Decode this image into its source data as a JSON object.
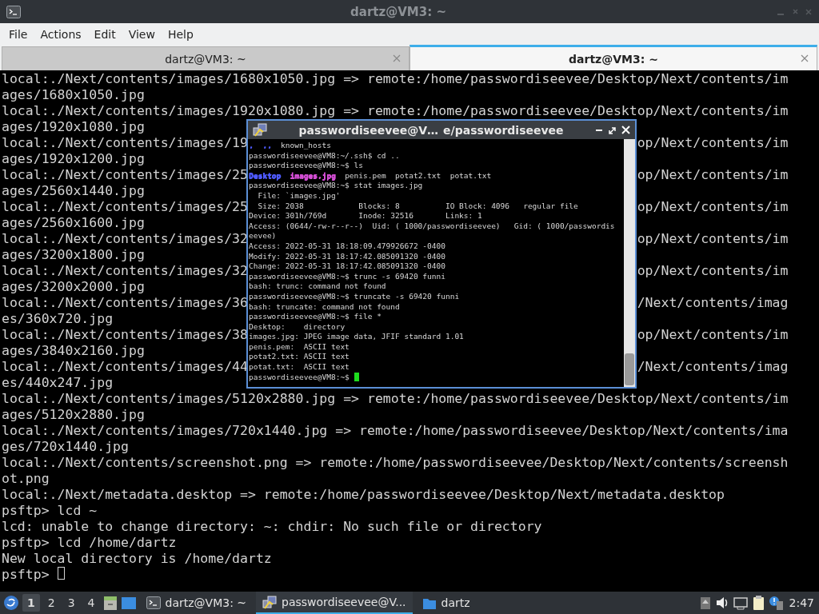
{
  "window": {
    "title": "dartz@VM3: ~"
  },
  "menu": [
    "File",
    "Actions",
    "Edit",
    "View",
    "Help"
  ],
  "tabs": [
    {
      "label": "dartz@VM3: ~",
      "selected": false
    },
    {
      "label": "dartz@VM3: ~",
      "selected": true
    }
  ],
  "terminal": {
    "lines": [
      {
        "text": "local:./Next/contents/images/1680x1050.jpg => remote:/home/passwordiseevee/Desktop/Next/contents/im"
      },
      {
        "text": "ages/1680x1050.jpg"
      },
      {
        "text": "local:./Next/contents/images/1920x1080.jpg => remote:/home/passwordiseevee/Desktop/Next/contents/im"
      },
      {
        "text": "ages/1920x1080.jpg"
      },
      {
        "left": "local:./Next/contents/images/19",
        "right": "op/Next/contents/im"
      },
      {
        "text": "ages/1920x1200.jpg"
      },
      {
        "left": "local:./Next/contents/images/25",
        "right": "op/Next/contents/im"
      },
      {
        "text": "ages/2560x1440.jpg"
      },
      {
        "left": "local:./Next/contents/images/25",
        "right": "op/Next/contents/im"
      },
      {
        "text": "ages/2560x1600.jpg"
      },
      {
        "left": "local:./Next/contents/images/32",
        "right": "op/Next/contents/im"
      },
      {
        "text": "ages/3200x1800.jpg"
      },
      {
        "left": "local:./Next/contents/images/32",
        "right": "op/Next/contents/im"
      },
      {
        "text": "ages/3200x2000.jpg"
      },
      {
        "left": "local:./Next/contents/images/36",
        "right": "/Next/contents/imag"
      },
      {
        "text": "es/360x720.jpg"
      },
      {
        "left": "local:./Next/contents/images/38",
        "right": "op/Next/contents/im"
      },
      {
        "text": "ages/3840x2160.jpg"
      },
      {
        "left": "local:./Next/contents/images/44",
        "right": "/Next/contents/imag"
      },
      {
        "text": "es/440x247.jpg"
      },
      {
        "text": "local:./Next/contents/images/5120x2880.jpg => remote:/home/passwordiseevee/Desktop/Next/contents/im"
      },
      {
        "text": "ages/5120x2880.jpg"
      },
      {
        "text": "local:./Next/contents/images/720x1440.jpg => remote:/home/passwordiseevee/Desktop/Next/contents/ima"
      },
      {
        "text": "ges/720x1440.jpg"
      },
      {
        "text": "local:./Next/contents/screenshot.png => remote:/home/passwordiseevee/Desktop/Next/contents/screensh"
      },
      {
        "text": "ot.png"
      },
      {
        "text": "local:./Next/metadata.desktop => remote:/home/passwordiseevee/Desktop/Next/metadata.desktop"
      },
      {
        "text": "psftp> lcd ~"
      },
      {
        "text": "lcd: unable to change directory: ~: chdir: No such file or directory"
      },
      {
        "text": "psftp> lcd /home/dartz"
      },
      {
        "text": "New local directory is /home/dartz"
      },
      {
        "text": "psftp> "
      }
    ]
  },
  "putty": {
    "title": "passwordiseevee@V…",
    "title_end": "e/passwordiseevee",
    "lines": [
      {
        "spans": [
          {
            "text": ".  ..",
            "color": "#4f5bff"
          },
          {
            "text": "  known_hosts"
          }
        ]
      },
      {
        "text": "passwordiseevee@VM8:~/.ssh$ cd .."
      },
      {
        "text": "passwordiseevee@VM8:~$ ls"
      },
      {
        "spans": [
          {
            "text": "Desktop  ",
            "color": "#4f5bff"
          },
          {
            "text": "images.jpg",
            "color": "#d64fd6"
          },
          {
            "text": "  penis.pem  potat2.txt  potat.txt"
          }
        ]
      },
      {
        "text": "passwordiseevee@VM8:~$ stat images.jpg"
      },
      {
        "text": "  File: `images.jpg'"
      },
      {
        "text": "  Size: 2038            Blocks: 8          IO Block: 4096   regular file"
      },
      {
        "text": "Device: 301h/769d       Inode: 32516       Links: 1"
      },
      {
        "text": "Access: (0644/-rw-r--r--)  Uid: ( 1000/passwordiseevee)   Gid: ( 1000/passwordis"
      },
      {
        "text": "eevee)"
      },
      {
        "text": "Access: 2022-05-31 18:18:09.479926672 -0400"
      },
      {
        "text": "Modify: 2022-05-31 18:17:42.085091320 -0400"
      },
      {
        "text": "Change: 2022-05-31 18:17:42.085091320 -0400"
      },
      {
        "text": "passwordiseevee@VM8:~$ trunc -s 69420 funni"
      },
      {
        "text": "bash: trunc: command not found"
      },
      {
        "text": "passwordiseevee@VM8:~$ truncate -s 69420 funni"
      },
      {
        "text": "bash: truncate: command not found"
      },
      {
        "text": "passwordiseevee@VM8:~$ file *"
      },
      {
        "text": "Desktop:    directory"
      },
      {
        "text": "images.jpg: JPEG image data, JFIF standard 1.01"
      },
      {
        "text": "penis.pem:  ASCII text"
      },
      {
        "text": "potat2.txt: ASCII text"
      },
      {
        "text": "potat.txt:  ASCII text"
      },
      {
        "text": "passwordiseevee@VM8:~$ "
      }
    ]
  },
  "taskbar": {
    "workspaces": [
      {
        "label": "1",
        "selected": true
      },
      {
        "label": "2",
        "selected": false
      },
      {
        "label": "3",
        "selected": false
      },
      {
        "label": "4",
        "selected": false
      }
    ],
    "tasks": [
      {
        "kind": "terminal",
        "label": "dartz@VM3: ~",
        "selected": false
      },
      {
        "kind": "remote",
        "label": "passwordiseevee@V...",
        "selected": true
      },
      {
        "kind": "folder",
        "label": "dartz",
        "selected": false
      }
    ],
    "clock": "2:47"
  }
}
